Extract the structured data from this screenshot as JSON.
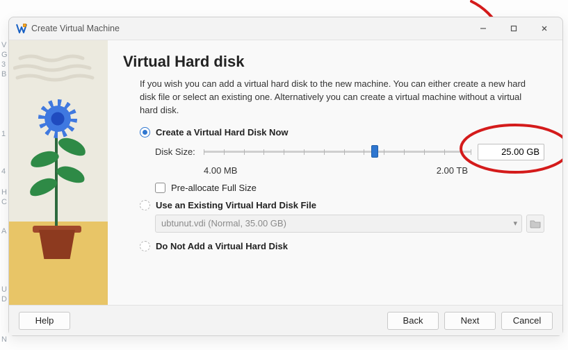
{
  "window": {
    "title": "Create Virtual Machine"
  },
  "page": {
    "heading": "Virtual Hard disk",
    "description": "If you wish you can add a virtual hard disk to the new machine. You can either create a new hard disk file or select an existing one. Alternatively you can create a virtual machine without a virtual hard disk."
  },
  "options": {
    "create_now": {
      "label": "Create a Virtual Hard Disk Now",
      "selected": true
    },
    "use_existing": {
      "label": "Use an Existing Virtual Hard Disk File",
      "selected": false,
      "file_display": "ubtunut.vdi (Normal, 35.00 GB)"
    },
    "do_not_add": {
      "label": "Do Not Add a Virtual Hard Disk",
      "selected": false
    }
  },
  "disk_size": {
    "label": "Disk Size:",
    "min_label": "4.00 MB",
    "max_label": "2.00 TB",
    "value_display": "25.00 GB",
    "thumb_percent": 64
  },
  "preallocate": {
    "label": "Pre-allocate Full Size",
    "checked": false
  },
  "buttons": {
    "help": "Help",
    "back": "Back",
    "next": "Next",
    "cancel": "Cancel"
  }
}
